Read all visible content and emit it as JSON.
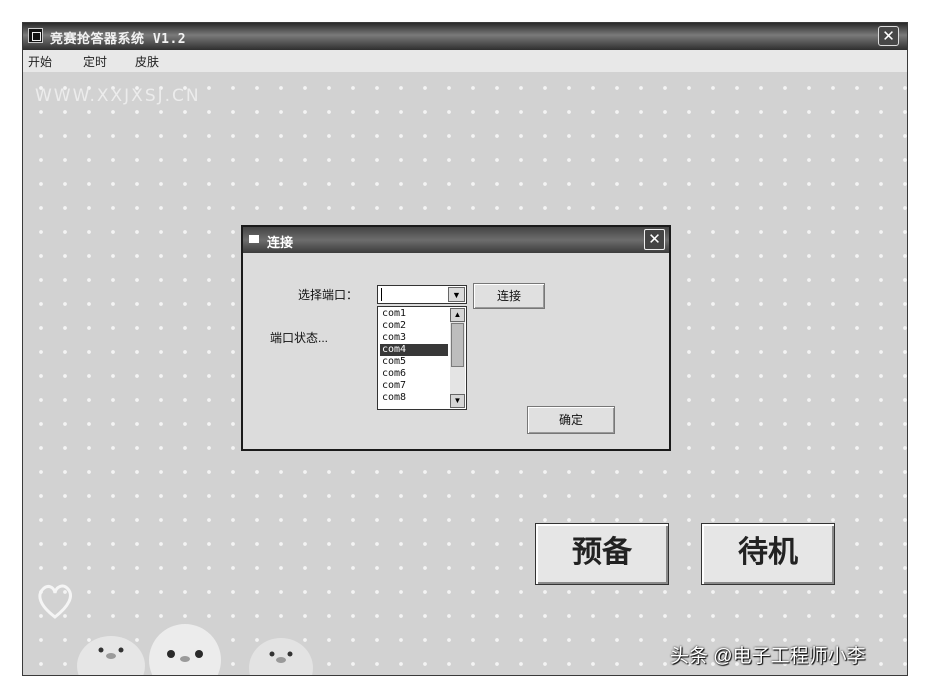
{
  "window": {
    "title": "竞赛抢答器系统 V1.2",
    "close_glyph": "✕"
  },
  "menu": {
    "items": [
      "开始",
      "定时",
      "皮肤"
    ]
  },
  "watermark": "WWW.XXJXSJ.CN",
  "dialog": {
    "title": "连接",
    "close_glyph": "✕",
    "port_label": "选择端口：",
    "status_label": "端口状态...",
    "connect_button": "连接",
    "ok_button": "确定",
    "port_value": "",
    "port_options": [
      "com1",
      "com2",
      "com3",
      "com4",
      "com5",
      "com6",
      "com7",
      "com8"
    ],
    "selected_option": "com4"
  },
  "buttons": {
    "ready": "预备",
    "standby": "待机"
  },
  "credit": "头条 @电子工程师小李",
  "icons": [
    "app-icon",
    "close-icon",
    "dialog-icon",
    "dropdown-arrow-icon",
    "scroll-up-icon",
    "scroll-down-icon",
    "heart-icon",
    "chick-icon"
  ]
}
